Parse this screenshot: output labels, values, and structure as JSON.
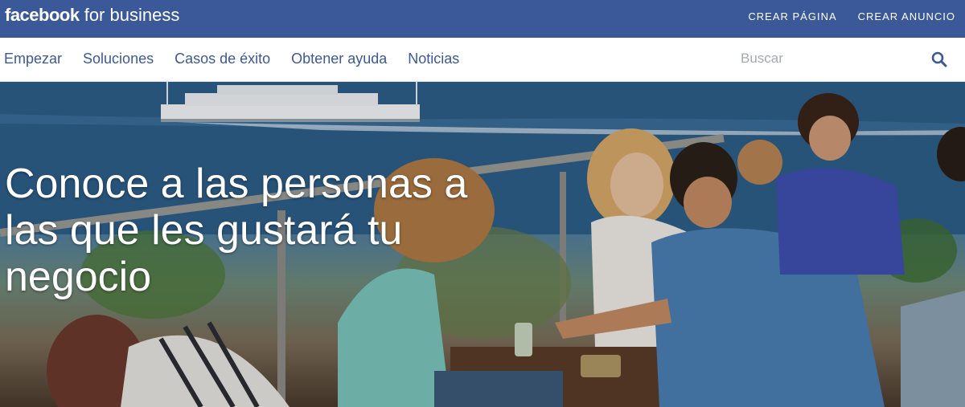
{
  "header": {
    "logo_brand": "facebook",
    "logo_suffix": " for business",
    "links": [
      "CREAR PÁGINA",
      "CREAR ANUNCIO"
    ]
  },
  "nav": {
    "items": [
      "Empezar",
      "Soluciones",
      "Casos de éxito",
      "Obtener ayuda",
      "Noticias"
    ]
  },
  "search": {
    "placeholder": "Buscar",
    "value": ""
  },
  "hero": {
    "headline": "Conoce a las personas a las que les gustará tu negocio",
    "image_description_icon": "photo-icon"
  },
  "colors": {
    "brand_blue": "#3b5998",
    "nav_text": "#3b5998",
    "header_text": "#ffffff"
  }
}
